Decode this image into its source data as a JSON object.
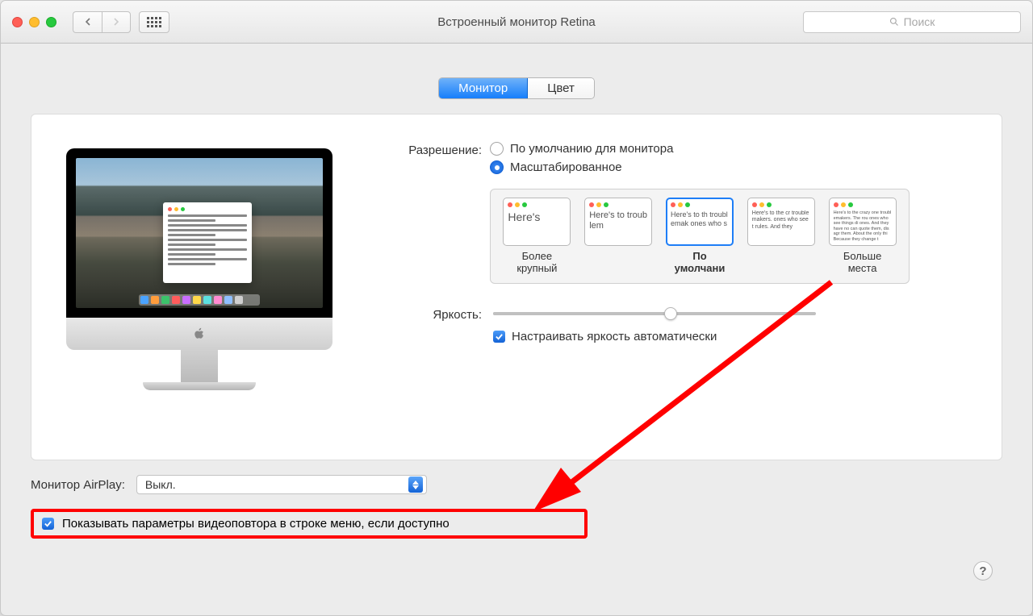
{
  "window_title": "Встроенный монитор Retina",
  "search_placeholder": "Поиск",
  "tabs": {
    "monitor": "Монитор",
    "color": "Цвет"
  },
  "resolution": {
    "label": "Разрешение:",
    "default": "По умолчанию для монитора",
    "scaled": "Масштабированное"
  },
  "res_opts": [
    {
      "label": "Более\nкрупный",
      "sample": "Here's"
    },
    {
      "label": "",
      "sample": "Here's to troublem"
    },
    {
      "label": "По\nумолчани",
      "sample": "Here's to th troublemak ones who s"
    },
    {
      "label": "",
      "sample": "Here's to the cr troublemakers. ones who see t rules. And they"
    },
    {
      "label": "Больше\nместа",
      "sample": "Here's to the crazy one troublemakers. The rou ones who see things di ones. And they have no can quote them, disagr them. About the only thi Because they change t"
    }
  ],
  "brightness": {
    "label": "Яркость:",
    "auto": "Настраивать яркость автоматически"
  },
  "airplay": {
    "label": "Монитор AirPlay:",
    "value": "Выкл."
  },
  "mirror_checkbox": "Показывать параметры видеоповтора в строке меню, если доступно",
  "help": "?"
}
